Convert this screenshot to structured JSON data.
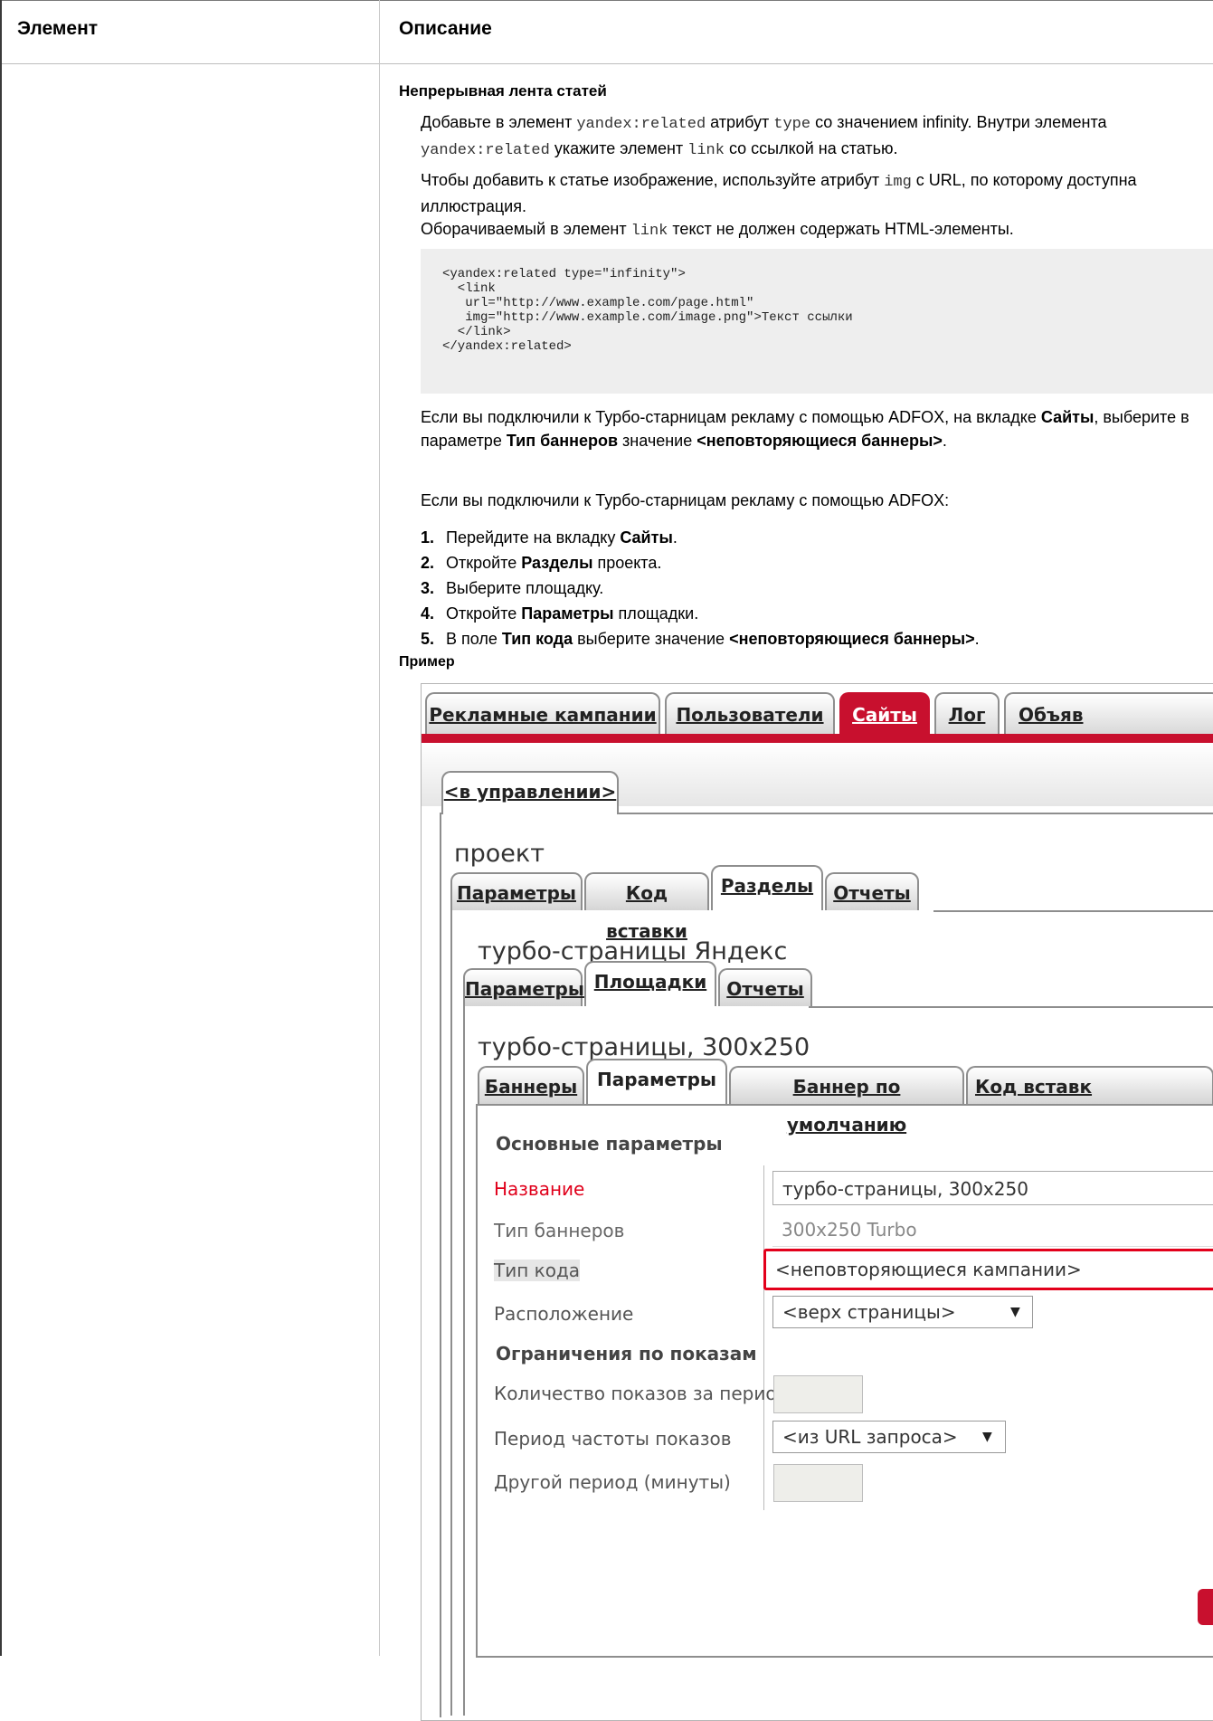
{
  "table": {
    "col_element": "Элемент",
    "col_description": "Описание"
  },
  "section": {
    "title": "Непрерывная лента статей",
    "p1_a": "Добавьте в элемент ",
    "p1_code1": "yandex:related",
    "p1_b": " атрибут ",
    "p1_code2": "type",
    "p1_c": " со значением infinity. Внутри элемента ",
    "p1_code3": "yandex:related",
    "p1_d": " укажите элемент ",
    "p1_code4": "link",
    "p1_e": " со ссылкой на статью.",
    "p2_a": "Чтобы добавить к статье изображение, используйте атрибут ",
    "p2_code": "img",
    "p2_b": " с URL, по которому доступна иллюстрация.",
    "p3_a": "Оборачиваемый в элемент ",
    "p3_code": "link",
    "p3_b": " текст не должен содержать HTML-элементы.",
    "code": "<yandex:related type=\"infinity\">\n  <link\n   url=\"http://www.example.com/page.html\"\n   img=\"http://www.example.com/image.png\">Текст ссылки\n  </link>\n</yandex:related>",
    "p4_a": "Если вы подключили к Турбо-старницам рекламу с помощью ADFOX, на вкладке ",
    "p4_b1": "Сайты",
    "p4_c": ", выберите в параметре ",
    "p4_b2": "Тип баннеров",
    "p4_d": " значение ",
    "p4_b3": "<неповторяющиеся баннеры>",
    "p4_e": ".",
    "p5": "Если вы подключили к Турбо-старницам рекламу с помощью ADFOX:",
    "steps": [
      {
        "n": "1.",
        "a": "Перейдите на вкладку ",
        "b": "Сайты",
        "c": "."
      },
      {
        "n": "2.",
        "a": "Откройте ",
        "b": "Разделы",
        "c": " проекта."
      },
      {
        "n": "3.",
        "a": "Выберите площадку.",
        "b": "",
        "c": ""
      },
      {
        "n": "4.",
        "a": "Откройте ",
        "b": "Параметры",
        "c": " площадки."
      },
      {
        "n": "5.",
        "a": "В поле ",
        "b": "Тип кода",
        "c": " выберите значение ",
        "d": "<неповторяющиеся баннеры>",
        "e": "."
      }
    ],
    "example_label": "Пример"
  },
  "screenshot": {
    "main_tabs": [
      "Рекламные кампании",
      "Пользователи",
      "Сайты",
      "Лог",
      "Объяв"
    ],
    "manage_tab": "<в управлении>",
    "project_title": "проект",
    "project_tabs": [
      "Параметры",
      "Код вставки",
      "Разделы",
      "Отчеты"
    ],
    "section_title": "турбо-страницы Яндекс",
    "section_tabs": [
      "Параметры",
      "Площадки",
      "Отчеты"
    ],
    "place_title": "турбо-страницы, 300x250",
    "place_tabs": [
      "Баннеры",
      "Параметры",
      "Баннер по умолчанию",
      "Код вставк"
    ],
    "basic_header": "Основные параметры",
    "name_label": "Название",
    "name_value": "турбо-страницы, 300x250",
    "banner_type_label": "Тип баннеров",
    "banner_type_value": "300x250 Turbo",
    "code_type_label": "Тип кода",
    "code_type_value": "<неповторяющиеся кампании>",
    "location_label": "Расположение",
    "location_value": "<верх страницы>",
    "limits_header": "Ограничения по показам",
    "count_label": "Количество показов за период",
    "period_label": "Период частоты показов",
    "period_value": "<из URL запроса>",
    "other_label": "Другой период (минуты)",
    "accent_red": "#c8102e"
  }
}
